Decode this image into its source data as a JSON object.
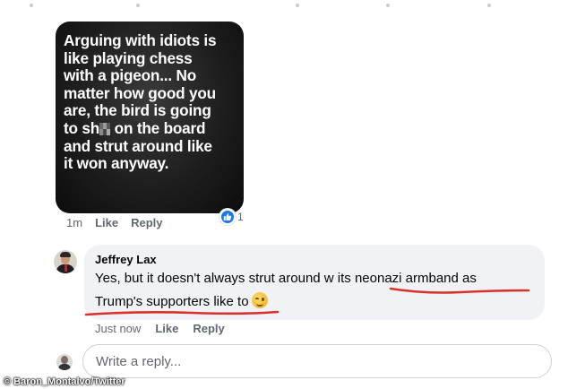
{
  "post": {
    "meme_lines": [
      "Arguing with idiots is",
      "like playing chess",
      "with a pigeon... No",
      "matter how good you",
      "are, the bird is going",
      "on the board",
      "and strut around like",
      "it won anyway."
    ],
    "meme_line6_prefix": "to sh",
    "time": "1m",
    "like_label": "Like",
    "reply_label": "Reply",
    "reaction_icon": "thumbs-up-icon",
    "reaction_count": "1"
  },
  "comment": {
    "author": "Jeffrey Lax",
    "text_part1": "Yes, but it doesn't always strut around w its neonazi armband as",
    "text_part2": "Trump's supporters like to",
    "emoji": "winking-face-icon",
    "time": "Just now",
    "like_label": "Like",
    "reply_label": "Reply"
  },
  "reply_box": {
    "placeholder": "Write a reply..."
  },
  "watermark": "© Baron_Montalvo/Twitter",
  "colors": {
    "accent": "#1877f2",
    "underline": "#d8322b",
    "bubble": "#f0f2f5"
  }
}
